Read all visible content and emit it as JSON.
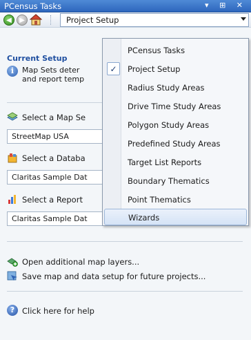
{
  "panel": {
    "title": "PCensus Tasks",
    "controls": "▾ † ✕"
  },
  "toolbar": {
    "combo_value": "Project Setup"
  },
  "current_setup": {
    "title": "Current Setup",
    "info_line1": "Map Sets deter",
    "info_line2": "and report temp"
  },
  "map_set": {
    "label": "Select a Map Se",
    "value": "StreetMap USA"
  },
  "database": {
    "label": "Select a Databa",
    "value": "Claritas Sample Dat"
  },
  "report": {
    "label": "Select a Report",
    "value": "Claritas Sample Dat"
  },
  "links": {
    "open_layers": "Open additional map layers...",
    "save_setup": "Save map and data setup for future projects...",
    "help": "Click here for help"
  },
  "menu": {
    "items": [
      {
        "label": "PCensus Tasks",
        "checked": false
      },
      {
        "label": "Project Setup",
        "checked": true
      },
      {
        "label": "Radius Study Areas",
        "checked": false
      },
      {
        "label": "Drive Time Study Areas",
        "checked": false
      },
      {
        "label": "Polygon Study Areas",
        "checked": false
      },
      {
        "label": "Predefined Study Areas",
        "checked": false
      },
      {
        "label": "Target List Reports",
        "checked": false
      },
      {
        "label": "Boundary Thematics",
        "checked": false
      },
      {
        "label": "Point Thematics",
        "checked": false
      },
      {
        "label": "Wizards",
        "checked": false,
        "hover": true
      }
    ]
  }
}
